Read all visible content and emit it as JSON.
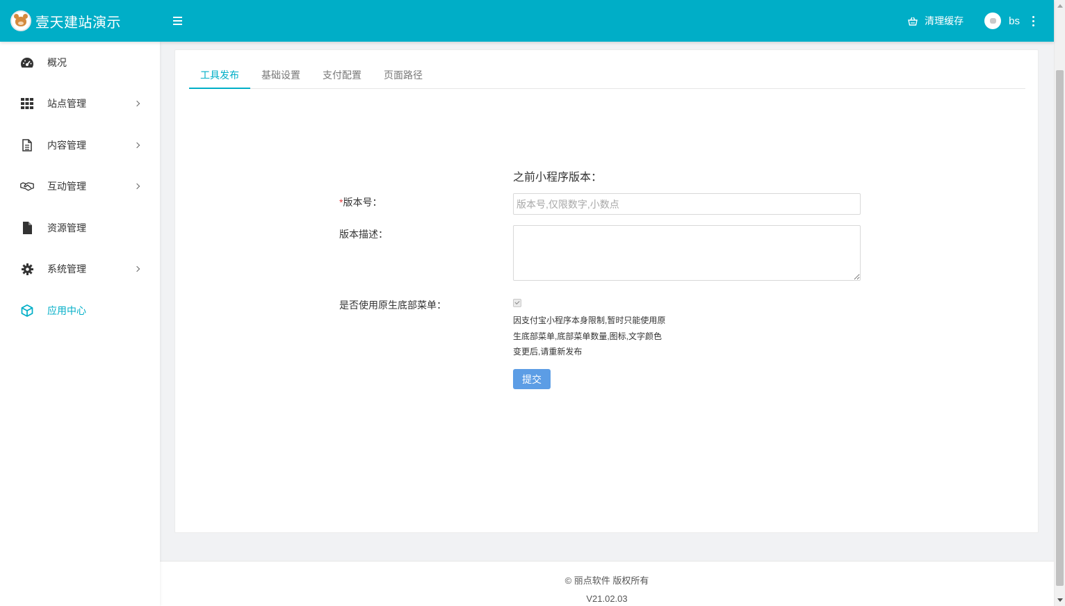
{
  "header": {
    "brand_title": "壹天建站演示",
    "clear_cache_label": "清理缓存",
    "user_name": "bs",
    "accent_color": "#00aec7"
  },
  "sidebar": {
    "items": [
      {
        "label": "概况",
        "icon": "dashboard-icon",
        "has_submenu": false
      },
      {
        "label": "站点管理",
        "icon": "grid-icon",
        "has_submenu": true
      },
      {
        "label": "内容管理",
        "icon": "document-icon",
        "has_submenu": true
      },
      {
        "label": "互动管理",
        "icon": "handshake-icon",
        "has_submenu": true
      },
      {
        "label": "资源管理",
        "icon": "file-icon",
        "has_submenu": false
      },
      {
        "label": "系统管理",
        "icon": "gear-icon",
        "has_submenu": true
      },
      {
        "label": "应用中心",
        "icon": "cube-icon",
        "has_submenu": false,
        "active": true
      }
    ]
  },
  "tabs": [
    {
      "label": "工具发布",
      "active": true
    },
    {
      "label": "基础设置"
    },
    {
      "label": "支付配置"
    },
    {
      "label": "页面路径"
    }
  ],
  "form": {
    "prev_version_label": "之前小程序版本：",
    "required_mark": "*",
    "version_label": "版本号：",
    "version_placeholder": "版本号,仅限数字,小数点",
    "version_value": "",
    "desc_label": "版本描述：",
    "desc_value": "",
    "native_menu_label": "是否使用原生底部菜单：",
    "native_menu_checked": true,
    "note_lines": [
      "因支付宝小程序本身限制,暂时只能使用原",
      "生底部菜单,底部菜单数量,图标,文字颜色",
      "变更后,请重新发布"
    ],
    "submit_label": "提交"
  },
  "footer": {
    "copyright": "© 丽点软件 版权所有",
    "version": "V21.02.03"
  }
}
